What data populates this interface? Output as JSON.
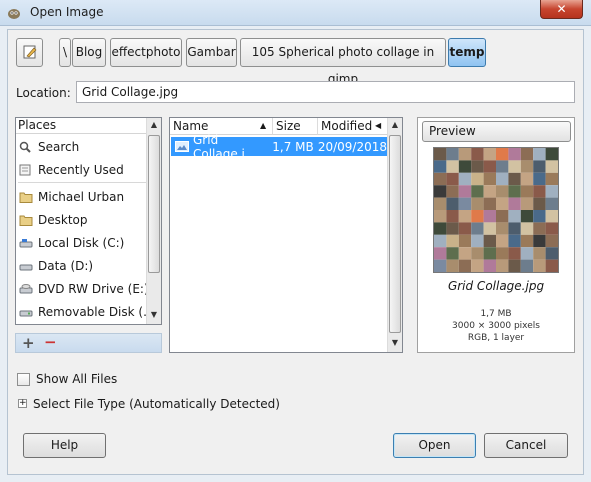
{
  "window": {
    "title": "Open Image",
    "close_label": "✕"
  },
  "path_bar": {
    "separator": "\\",
    "crumbs": [
      "Blog",
      "effectphoto",
      "Gambar",
      "105 Spherical photo collage in gimp",
      "temp"
    ]
  },
  "location": {
    "label": "Location:",
    "value": "Grid Collage.jpg"
  },
  "places": {
    "header": "Places",
    "items": [
      {
        "label": "Search",
        "icon": "magnifier-icon"
      },
      {
        "label": "Recently Used",
        "icon": "clock-icon"
      },
      {
        "label": "Michael Urban",
        "icon": "folder-icon"
      },
      {
        "label": "Desktop",
        "icon": "folder-icon"
      },
      {
        "label": "Local Disk (C:)",
        "icon": "hard-disk-icon"
      },
      {
        "label": "Data (D:)",
        "icon": "hard-disk-icon"
      },
      {
        "label": "DVD RW Drive (E:)",
        "icon": "optical-drive-icon"
      },
      {
        "label": "Removable Disk (...",
        "icon": "removable-disk-icon"
      }
    ],
    "add_symbol": "+",
    "remove_symbol": "−"
  },
  "files": {
    "columns": {
      "name": "Name",
      "size": "Size",
      "modified": "Modified"
    },
    "rows": [
      {
        "name": "Grid Collage.j...",
        "size": "1,7 MB",
        "modified": "20/09/2018",
        "selected": true
      }
    ]
  },
  "preview": {
    "button": "Preview",
    "filename": "Grid Collage.jpg",
    "size": "1,7 MB",
    "dimensions": "3000 × 3000 pixels",
    "mode": "RGB, 1 layer"
  },
  "options": {
    "show_all_files": "Show All Files",
    "show_all_checked": false,
    "expander_symbol": "+",
    "select_file_type": "Select File Type (Automatically Detected)"
  },
  "buttons": {
    "help": "Help",
    "open": "Open",
    "cancel": "Cancel"
  },
  "colors": {
    "selection": "#3399ff",
    "accent": "#3d7bad"
  }
}
